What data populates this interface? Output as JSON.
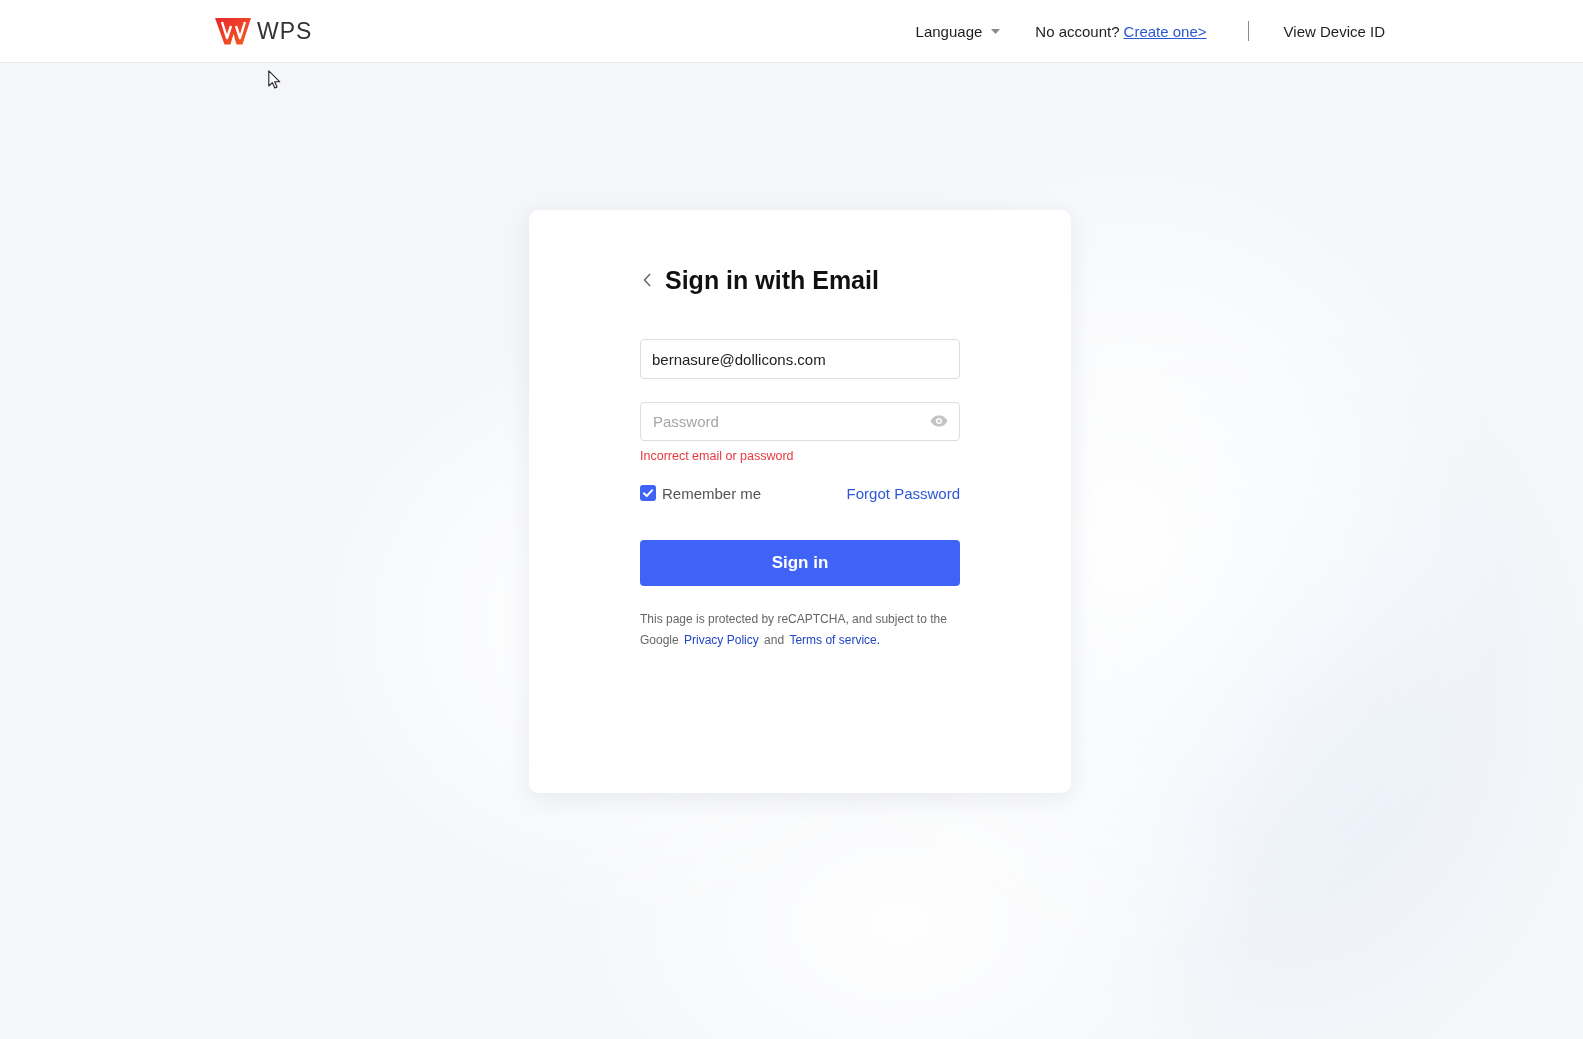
{
  "header": {
    "logo": {
      "text": "WPS"
    },
    "language": {
      "label": "Language"
    },
    "signup_prompt": {
      "text": "No account?",
      "link": "Create one>"
    },
    "device_id_link": "View Device ID"
  },
  "card": {
    "title": "Sign in with Email",
    "fields": [
      {
        "kind": "email",
        "value": "bernasure@dollicons.com"
      },
      {
        "kind": "password",
        "placeholder": "Password"
      }
    ],
    "error": "Incorrect email or password",
    "remember": {
      "label": "Remember me",
      "checked": true
    },
    "forgot_link": "Forgot Password",
    "submit": "Sign in",
    "notice": [
      {
        "kind": "text",
        "text": "This page is protected by reCAPTCHA, and subject to the Google "
      },
      {
        "kind": "link",
        "text": "Privacy Policy"
      },
      {
        "kind": "text",
        "text": " and "
      },
      {
        "kind": "link",
        "text": "Terms of service."
      }
    ]
  }
}
